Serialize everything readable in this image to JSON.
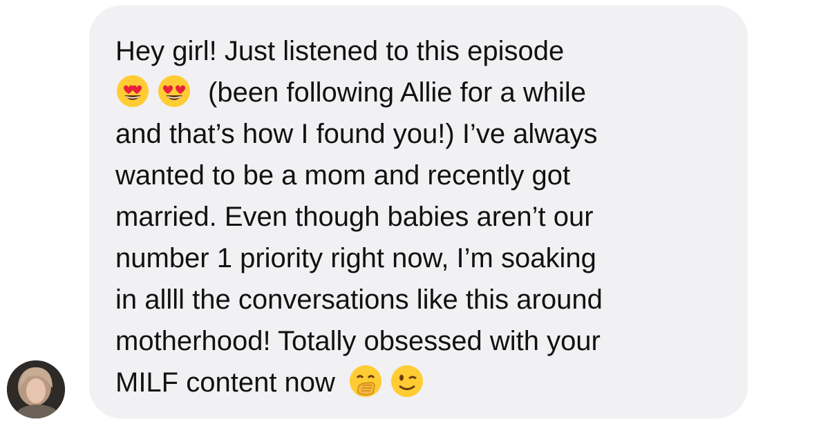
{
  "message": {
    "sender_avatar": "user-avatar-photo",
    "lines": [
      "Hey girl! Just listened to this episode",
      "(been following Allie for a while",
      "and that’s how I found you!) I’ve always",
      "wanted to be a mom and recently got",
      "married. Even though babies aren’t our",
      "number 1 priority right now, I’m soaking",
      "in allll the conversations like this around",
      "motherhood! Totally obsessed with your",
      "MILF content now"
    ],
    "emojis": {
      "line2": [
        "heart-eyes-emoji",
        "heart-eyes-emoji"
      ],
      "end": [
        "hand-over-mouth-emoji",
        "winking-face-emoji"
      ]
    }
  },
  "colors": {
    "bubble": "#f1f1f3",
    "text": "#111111",
    "emoji_face": "#ffcc33",
    "heart": "#e8213a"
  }
}
